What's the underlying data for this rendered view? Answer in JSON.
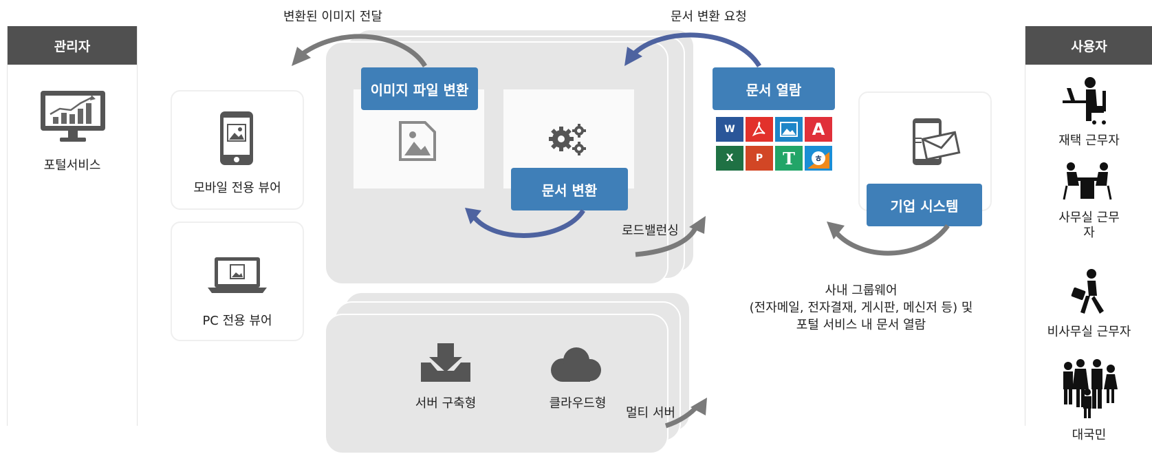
{
  "left_panel": {
    "header": "관리자",
    "item_label": "포털서비스"
  },
  "right_panel": {
    "header": "사용자",
    "users": [
      "재택 근무자",
      "사무실 근무\n자",
      "비사무실 근무자",
      "대국민"
    ]
  },
  "viewers": {
    "mobile": "모바일 전용 뷰어",
    "pc": "PC 전용 뷰어"
  },
  "server_main": {
    "image_convert": "이미지 파일 변환",
    "doc_convert": "문서 변환"
  },
  "server_deploy": {
    "onprem": "서버 구축형",
    "cloud": "클라우드형"
  },
  "doc_view": {
    "title": "문서 열람",
    "formats": [
      "word",
      "pdf",
      "image",
      "hwp-a",
      "excel",
      "powerpoint",
      "text",
      "hangul"
    ]
  },
  "enterprise": {
    "title": "기업 시스템"
  },
  "annotations": {
    "converted_image": "변환된 이미지 전달",
    "convert_request": "문서 변환 요청",
    "load_balancing": "로드밸런싱",
    "multi_server": "멀티 서버",
    "groupware_line1": "사내 그룹웨어",
    "groupware_line2": "(전자메일, 전자결재, 게시판, 메신저 등) 및",
    "groupware_line3": "포털 서비스 내 문서 열람"
  },
  "colors": {
    "header_bg": "#505050",
    "blue_button": "#3f7fb8",
    "arrow_gray": "#7a7a7a",
    "arrow_blue": "#4e63a0",
    "stack_bg": "#e6e6e6"
  }
}
